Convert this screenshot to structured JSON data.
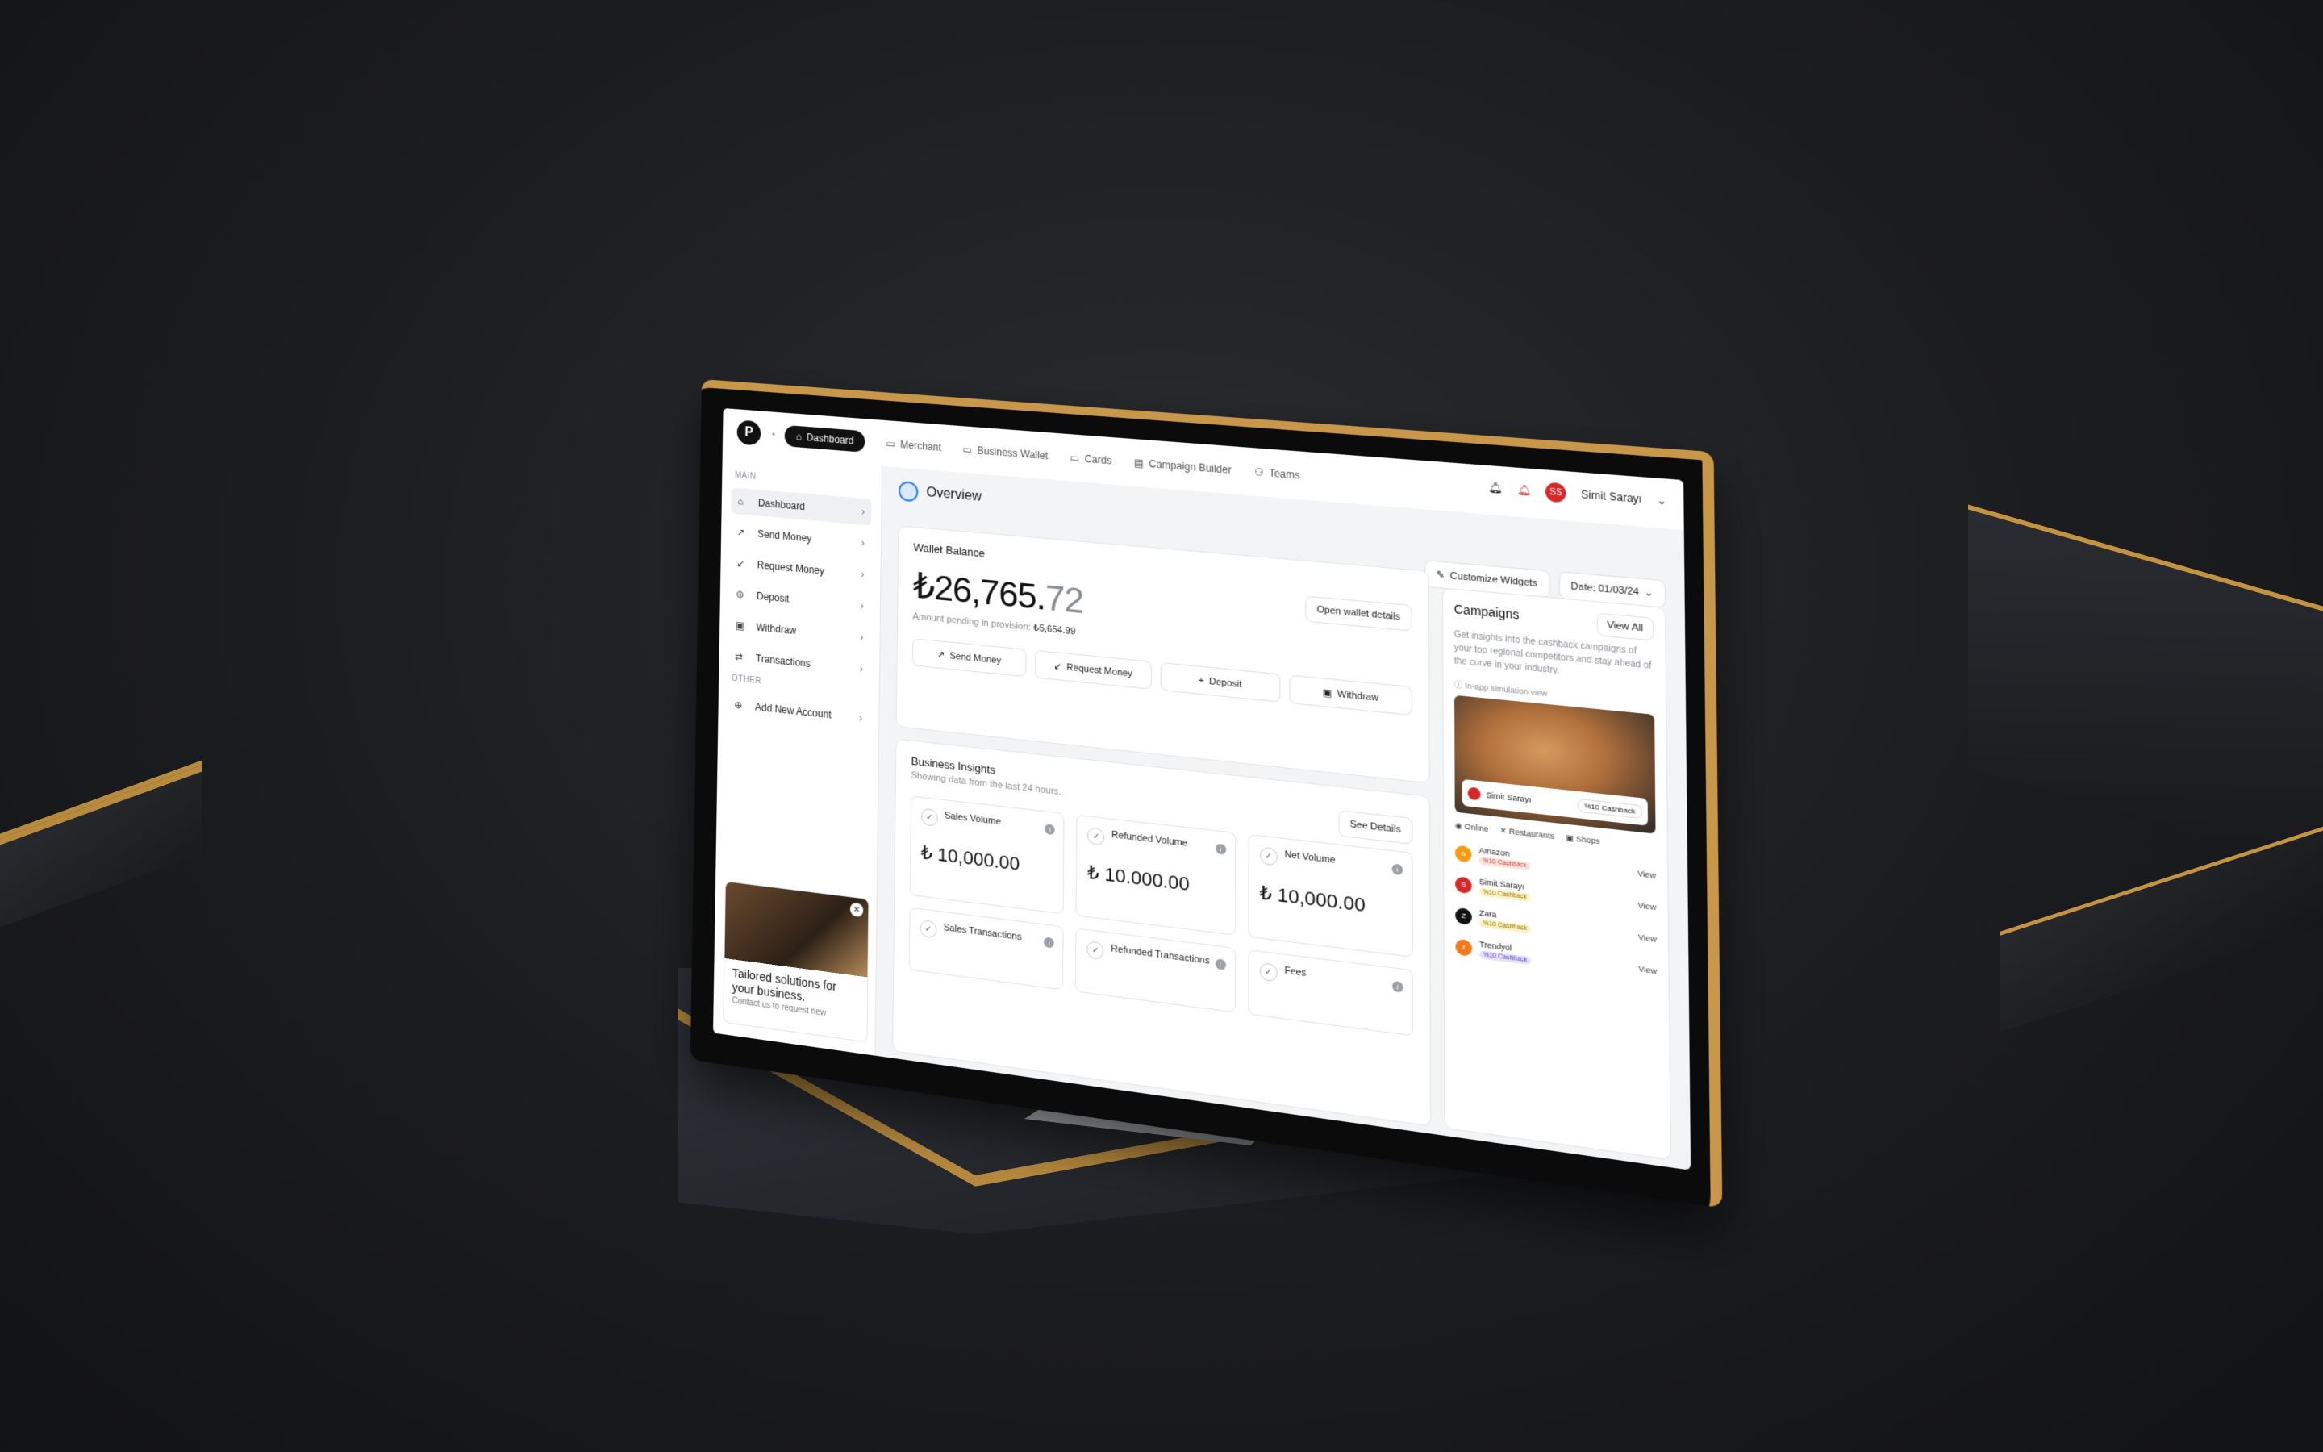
{
  "nav": {
    "items": [
      {
        "label": "Dashboard",
        "icon": "home-icon",
        "active": true
      },
      {
        "label": "Merchant",
        "icon": "store-icon"
      },
      {
        "label": "Business Wallet",
        "icon": "wallet-icon"
      },
      {
        "label": "Cards",
        "icon": "card-icon"
      },
      {
        "label": "Campaign Builder",
        "icon": "layout-icon"
      },
      {
        "label": "Teams",
        "icon": "users-icon"
      }
    ],
    "user_name": "Simit Sarayı",
    "user_initial": "SS"
  },
  "sidebar": {
    "main_label": "MAIN",
    "items": [
      {
        "label": "Dashboard",
        "icon": "home-icon",
        "active": true
      },
      {
        "label": "Send Money",
        "icon": "arrow-up-right-icon"
      },
      {
        "label": "Request Money",
        "icon": "arrow-down-left-icon"
      },
      {
        "label": "Deposit",
        "icon": "deposit-icon"
      },
      {
        "label": "Withdraw",
        "icon": "withdraw-icon"
      },
      {
        "label": "Transactions",
        "icon": "swap-icon"
      }
    ],
    "other_label": "OTHER",
    "other_items": [
      {
        "label": "Add New Account",
        "icon": "plus-circle-icon"
      }
    ],
    "promo": {
      "title": "Tailored solutions for your business.",
      "subtitle": "Contact us to request new"
    }
  },
  "main": {
    "title": "Overview",
    "customize_label": "Customize Widgets",
    "date_label": "Date: 01/03/24",
    "wallet": {
      "title": "Wallet Balance",
      "amount_main": "₺26,765.",
      "amount_cents": "72",
      "pending_label": "Amount pending in provision:",
      "pending_value": "₺5,654.99",
      "open_label": "Open wallet details",
      "actions": [
        "Send Money",
        "Request Money",
        "Deposit",
        "Withdraw"
      ]
    },
    "insights": {
      "title": "Business Insights",
      "subtitle": "Showing data from the last 24 hours.",
      "see_details": "See Details",
      "metrics": [
        {
          "label": "Sales Volume",
          "value": "₺ 10,000.00"
        },
        {
          "label": "Refunded Volume",
          "value": "₺ 10.000.00"
        },
        {
          "label": "Net Volume",
          "value": "₺ 10,000.00"
        },
        {
          "label": "Sales Transactions",
          "value": ""
        },
        {
          "label": "Refunded Transactions",
          "value": ""
        },
        {
          "label": "Fees",
          "value": ""
        }
      ]
    },
    "campaigns": {
      "title": "Campaigns",
      "view_all": "View All",
      "description": "Get insights into the cashback campaigns of your top regional competitors and stay ahead of the curve in your industry.",
      "preview_label": "In-app simulation view",
      "preview_name": "Simit Sarayı",
      "preview_cashback": "%10 Cashback",
      "tabs": [
        "Online",
        "Restaurants",
        "Shops"
      ],
      "rows": [
        {
          "name": "Amazon",
          "badge": "%10 Cashback",
          "view": "View",
          "color": "#f39c12",
          "badge_color": "#fde2e2"
        },
        {
          "name": "Simit Sarayı",
          "badge": "%10 Cashback",
          "view": "View",
          "color": "#d4282a",
          "badge_color": "#fdf2c4"
        },
        {
          "name": "Zara",
          "badge": "%10 Cashback",
          "view": "View",
          "color": "#111111",
          "badge_color": "#fdf2c4"
        },
        {
          "name": "Trendyol",
          "badge": "%10 Cashback",
          "view": "View",
          "color": "#f27a1a",
          "badge_color": "#e6e0fb"
        }
      ]
    }
  }
}
